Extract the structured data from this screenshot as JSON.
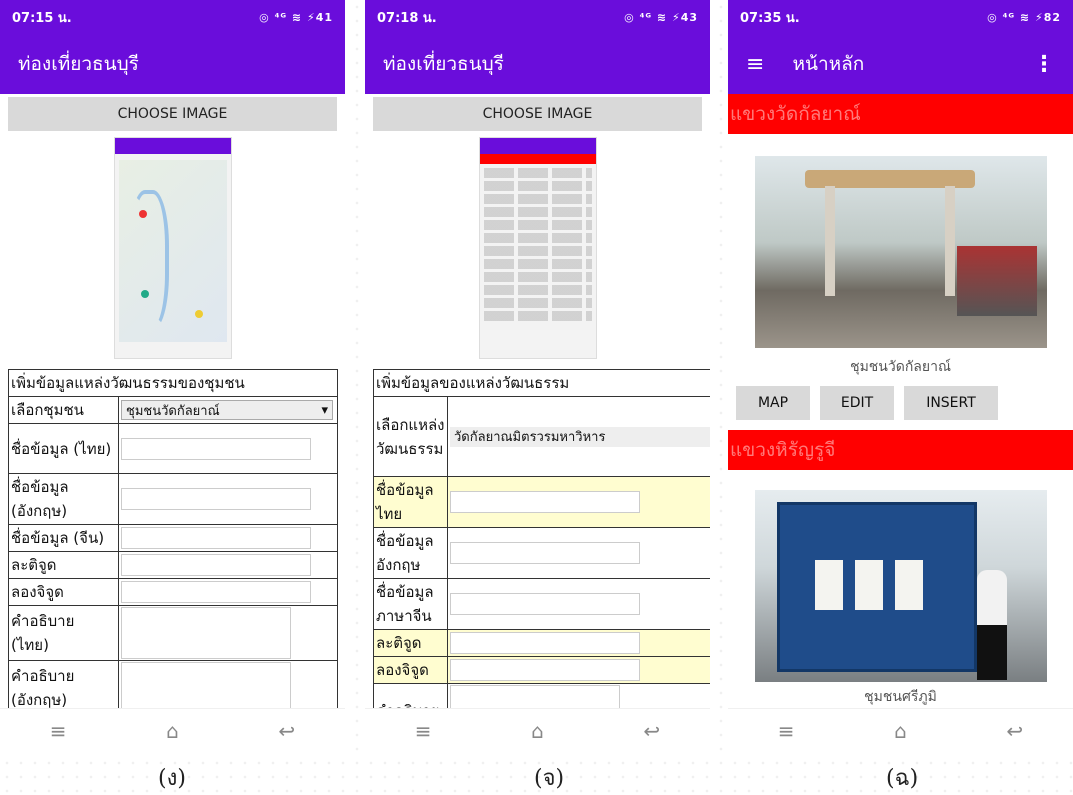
{
  "phone1": {
    "status_time": "07:15 น.",
    "status_right": "◎ ⁴ᴳ ≋ ⚡41",
    "app_title": "ท่องเที่ยวธนบุรี",
    "choose_label": "CHOOSE IMAGE",
    "form_title": "เพิ่มข้อมูลแหล่งวัฒนธรรมของชุมชน",
    "rows": [
      {
        "label": "เลือกชุมชน",
        "type": "select",
        "value": "ชุมชนวัดกัลยาณ์"
      },
      {
        "label": "ชื่อข้อมูล (ไทย)",
        "type": "input"
      },
      {
        "label": "ชื่อข้อมูล (อังกฤษ)",
        "type": "input"
      },
      {
        "label": "ชื่อข้อมูล (จีน)",
        "type": "input"
      },
      {
        "label": "ละติจูด",
        "type": "input"
      },
      {
        "label": "ลองจิจูด",
        "type": "input"
      },
      {
        "label": "คำอธิบาย (ไทย)",
        "type": "textarea"
      },
      {
        "label": "คำอธิบาย (อังกฤษ)",
        "type": "textarea"
      }
    ],
    "caption": "(ง)"
  },
  "phone2": {
    "status_time": "07:18 น.",
    "status_right": "◎ ⁴ᴳ ≋ ⚡43",
    "app_title": "ท่องเที่ยวธนบุรี",
    "choose_label": "CHOOSE IMAGE",
    "form_title": "เพิ่มข้อมูลของแหล่งวัฒนธรรม",
    "rows": [
      {
        "label": "เลือกแหล่งวัฒนธรรม",
        "type": "select",
        "value": "วัดกัลยาณมิตรวรมหาวิหาร"
      },
      {
        "label": "ชื่อข้อมูลไทย",
        "type": "input",
        "highlight": true
      },
      {
        "label": "ชื่อข้อมูลอังกฤษ",
        "type": "input"
      },
      {
        "label": "ชื่อข้อมูลภาษาจีน",
        "type": "input"
      },
      {
        "label": "ละติจูด",
        "type": "input",
        "highlight": true
      },
      {
        "label": "ลองจิจูด",
        "type": "input",
        "highlight": true
      },
      {
        "label": "คำอธิบาย",
        "type": "textarea"
      }
    ],
    "caption": "(จ)"
  },
  "phone3": {
    "status_time": "07:35 น.",
    "status_right": "◎ ⁴ᴳ ≋ ⚡82",
    "app_title": "หน้าหลัก",
    "section1": "แขวงวัดกัลยาณ์",
    "photo1_caption": "ชุมชนวัดกัลยาณ์",
    "buttons": [
      "MAP",
      "EDIT",
      "INSERT"
    ],
    "section2": "แขวงหิรัญรูจี",
    "photo2_caption": "ชุมชนศรีภูมิ",
    "caption": "(ฉ)"
  },
  "nav_icons": [
    "menu-lines-icon",
    "home-icon",
    "back-icon"
  ],
  "colors": {
    "appbar": "#6a0ddb",
    "section": "#ff0000",
    "highlight": "#fffdd0"
  }
}
